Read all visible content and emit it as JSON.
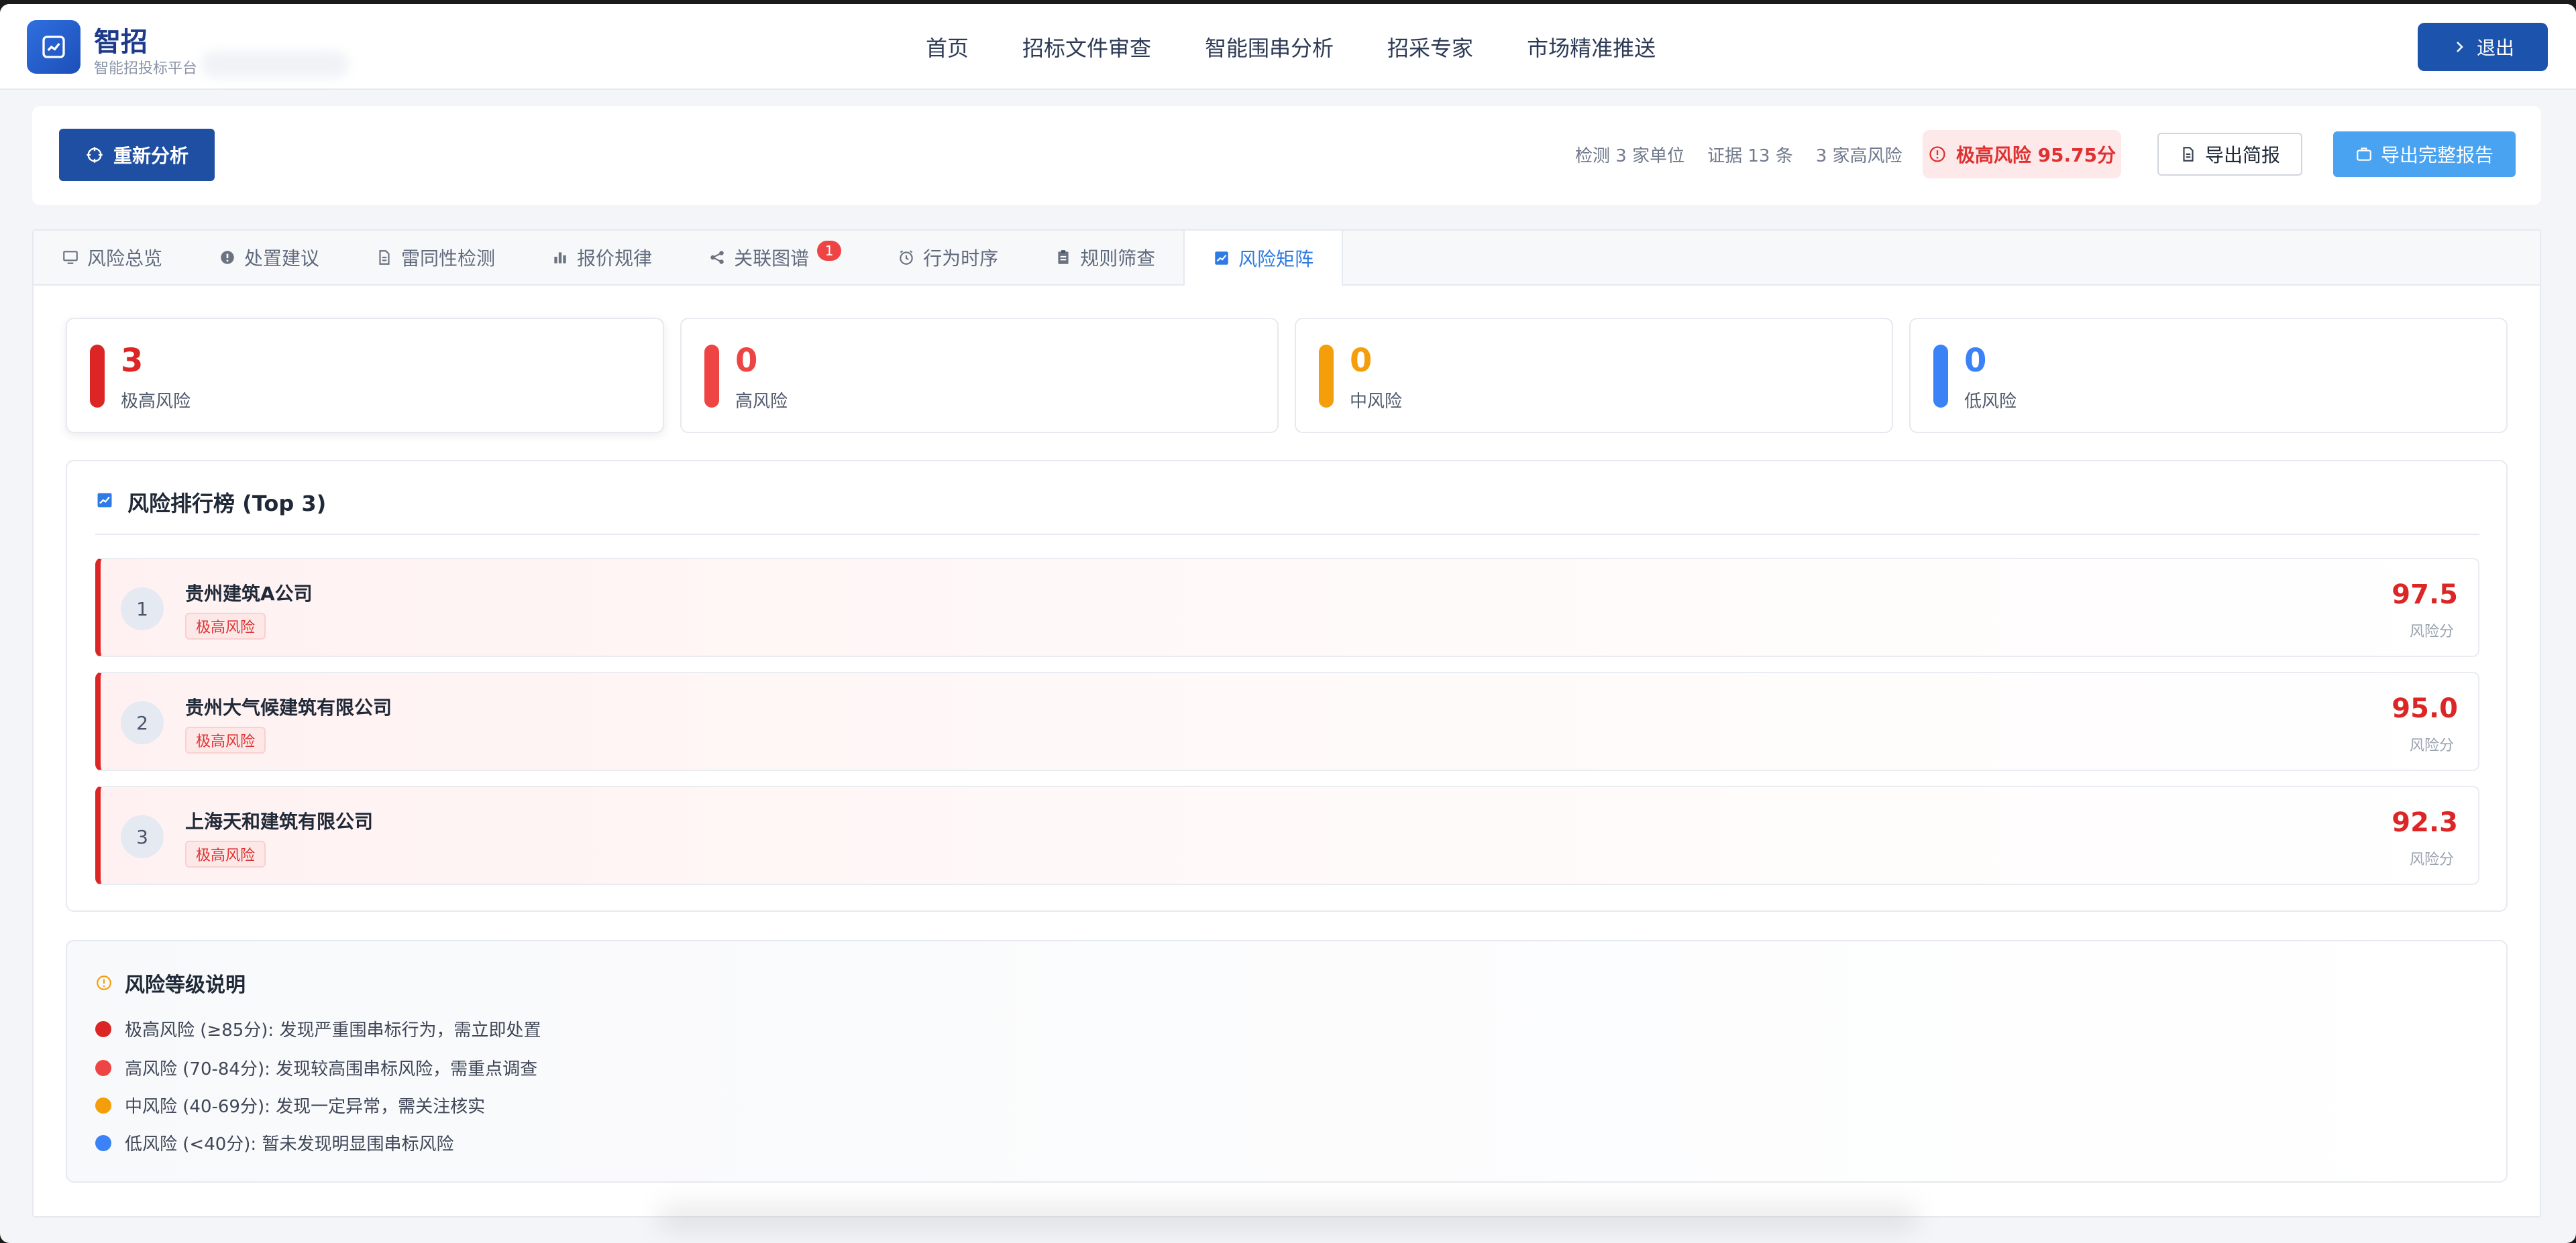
{
  "app": {
    "title": "智招",
    "subtitle": "智能招投标平台",
    "accent": "#1c54ad"
  },
  "nav": {
    "items": [
      "首页",
      "招标文件审查",
      "智能围串分析",
      "招采专家",
      "市场精准推送"
    ],
    "logout_label": "退出"
  },
  "toolbar": {
    "reanalyze_label": "重新分析",
    "stats": [
      "检测 3 家单位",
      "证据 13 条",
      "3 家高风险"
    ],
    "risk_badge": "极高风险 95.75分",
    "export_brief_label": "导出简报",
    "export_full_label": "导出完整报告"
  },
  "tabs": [
    {
      "label": "风险总览",
      "icon": "monitor-icon"
    },
    {
      "label": "处置建议",
      "icon": "alert-circle-icon"
    },
    {
      "label": "雷同性检测",
      "icon": "document-icon"
    },
    {
      "label": "报价规律",
      "icon": "bar-chart-icon"
    },
    {
      "label": "关联图谱",
      "icon": "share-icon",
      "badge": "1"
    },
    {
      "label": "行为时序",
      "icon": "alarm-clock-icon"
    },
    {
      "label": "规则筛查",
      "icon": "clipboard-icon"
    },
    {
      "label": "风险矩阵",
      "icon": "line-chart-icon",
      "active": true
    }
  ],
  "summary": [
    {
      "value": "3",
      "label": "极高风险",
      "color": "#dc2626"
    },
    {
      "value": "0",
      "label": "高风险",
      "color": "#ef4444"
    },
    {
      "value": "0",
      "label": "中风险",
      "color": "#f59e0b"
    },
    {
      "value": "0",
      "label": "低风险",
      "color": "#3b82f6"
    }
  ],
  "ranking": {
    "title": "风险排行榜 (Top 3)",
    "score_label": "风险分",
    "rows": [
      {
        "rank": "1",
        "name": "贵州建筑A公司",
        "tag": "极高风险",
        "score": "97.5"
      },
      {
        "rank": "2",
        "name": "贵州大气候建筑有限公司",
        "tag": "极高风险",
        "score": "95.0"
      },
      {
        "rank": "3",
        "name": "上海天和建筑有限公司",
        "tag": "极高风险",
        "score": "92.3"
      }
    ]
  },
  "legend": {
    "title": "风险等级说明",
    "items": [
      {
        "text": "极高风险 (≥85分): 发现严重围串标行为，需立即处置",
        "color": "#dc2626"
      },
      {
        "text": "高风险 (70-84分): 发现较高围串标风险，需重点调查",
        "color": "#ef4444"
      },
      {
        "text": "中风险 (40-69分): 发现一定异常，需关注核实",
        "color": "#f59e0b"
      },
      {
        "text": "低风险 (<40分): 暂未发现明显围串标风险",
        "color": "#3b82f6"
      }
    ]
  }
}
